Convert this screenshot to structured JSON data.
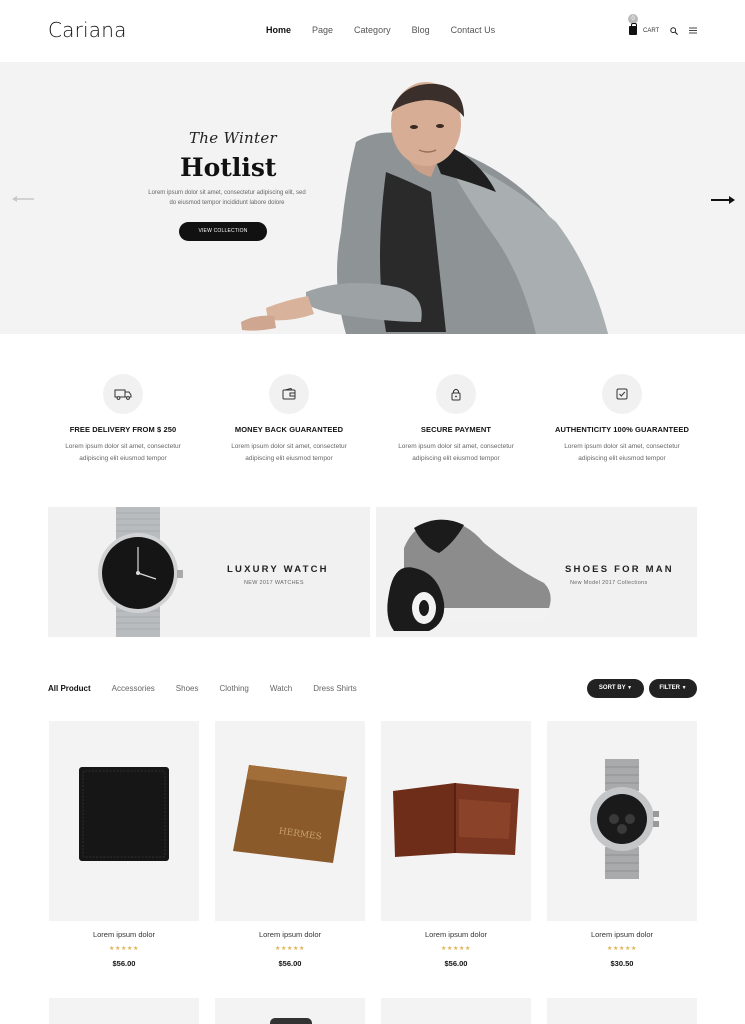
{
  "brand": "Cariana",
  "nav": [
    "Home",
    "Page",
    "Category",
    "Blog",
    "Contact Us"
  ],
  "cart": {
    "count": "0",
    "label": "CART"
  },
  "hero": {
    "subtitle": "The Winter",
    "title": "Hotlist",
    "description": "Lorem ipsum dolor sit amet, consectetur adipiscing elit, sed do eiusmod tempor incididunt labore dolore",
    "button": "VIEW COLLECTION"
  },
  "features": [
    {
      "icon": "truck-icon",
      "title": "FREE DELIVERY FROM $ 250",
      "desc1": "Lorem ipsum dolor sit amet, consectetur",
      "desc2": "adipiscing elit eiusmod tempor"
    },
    {
      "icon": "wallet-icon",
      "title": "MONEY BACK GUARANTEED",
      "desc1": "Lorem ipsum dolor sit amet, consectetur",
      "desc2": "adipiscing elit eiusmod tempor"
    },
    {
      "icon": "lock-icon",
      "title": "SECURE PAYMENT",
      "desc1": "Lorem ipsum dolor sit amet, consectetur",
      "desc2": "adipiscing elit eiusmod tempor"
    },
    {
      "icon": "checkbox-icon",
      "title": "AUTHENTICITY 100% GUARANTEED",
      "desc1": "Lorem ipsum dolor sit amet, consectetur",
      "desc2": "adipiscing elit eiusmod tempor"
    }
  ],
  "banners": [
    {
      "title": "LUXURY WATCH",
      "subtitle": "NEW 2017 WATCHES"
    },
    {
      "title": "SHOES FOR MAN",
      "subtitle": "New Model 2017 Collections"
    }
  ],
  "tabs": [
    "All Product",
    "Accessories",
    "Shoes",
    "Clothing",
    "Watch",
    "Dress Shirts"
  ],
  "sort_label": "SORT BY",
  "filter_label": "FILTER",
  "products": [
    {
      "name": "Lorem ipsum dolor",
      "price": "$56.00",
      "stars": "★★★★★"
    },
    {
      "name": "Lorem ipsum dolor",
      "price": "$56.00",
      "stars": "★★★★★"
    },
    {
      "name": "Lorem ipsum dolor",
      "price": "$56.00",
      "stars": "★★★★★"
    },
    {
      "name": "Lorem ipsum dolor",
      "price": "$30.50",
      "stars": "★★★★★"
    }
  ],
  "colors": {
    "dark": "#111111",
    "star": "#e0b250",
    "panel": "#f1f1f1"
  }
}
